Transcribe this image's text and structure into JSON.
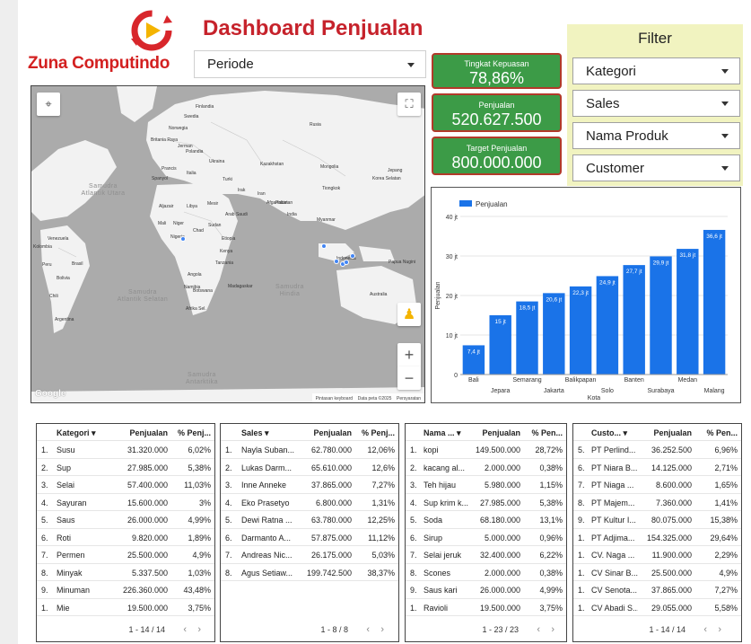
{
  "brand": {
    "name": "Zuna Computindo"
  },
  "header": {
    "title": "Dashboard Penjualan",
    "period_label": "Periode"
  },
  "kpis": [
    {
      "label": "Tingkat Kepuasan",
      "value": "78,86%"
    },
    {
      "label": "Penjualan",
      "value": "520.627.500"
    },
    {
      "label": "Target Penjualan",
      "value": "800.000.000"
    }
  ],
  "filter": {
    "title": "Filter",
    "items": [
      "Kategori",
      "Sales",
      "Nama Produk",
      "Customer"
    ]
  },
  "map": {
    "countries": [
      {
        "name": "Finlandia"
      },
      {
        "name": "Swedia"
      },
      {
        "name": "Norwegia"
      },
      {
        "name": "Rusia"
      },
      {
        "name": "Britania Raya"
      },
      {
        "name": "Jerman"
      },
      {
        "name": "Polandia"
      },
      {
        "name": "Prancis"
      },
      {
        "name": "Ukraina"
      },
      {
        "name": "Kazakhstan"
      },
      {
        "name": "Mongolia"
      },
      {
        "name": "Spanyol"
      },
      {
        "name": "Italia"
      },
      {
        "name": "Turki"
      },
      {
        "name": "Irak"
      },
      {
        "name": "Iran"
      },
      {
        "name": "Afganistan"
      },
      {
        "name": "Tiongkok"
      },
      {
        "name": "Jepang"
      },
      {
        "name": "Korea Selatan"
      },
      {
        "name": "Aljazair"
      },
      {
        "name": "Libya"
      },
      {
        "name": "Mesir"
      },
      {
        "name": "Pakistan"
      },
      {
        "name": "India"
      },
      {
        "name": "Myanmar"
      },
      {
        "name": "Arab Saudi"
      },
      {
        "name": "Mali"
      },
      {
        "name": "Niger"
      },
      {
        "name": "Chad"
      },
      {
        "name": "Sudan"
      },
      {
        "name": "Nigeria"
      },
      {
        "name": "Etiopia"
      },
      {
        "name": "Kenya"
      },
      {
        "name": "Tanzania"
      },
      {
        "name": "Angola"
      },
      {
        "name": "Namibia"
      },
      {
        "name": "Botswana"
      },
      {
        "name": "Afrika Sel."
      },
      {
        "name": "Madagaskar"
      },
      {
        "name": "Indonesia"
      },
      {
        "name": "Papua Nugini"
      },
      {
        "name": "Australia"
      },
      {
        "name": "Venezuela"
      },
      {
        "name": "Kolombia"
      },
      {
        "name": "Peru"
      },
      {
        "name": "Brasil"
      },
      {
        "name": "Bolivia"
      },
      {
        "name": "Chili"
      },
      {
        "name": "Argentina"
      }
    ],
    "oceans": [
      {
        "name": "Samudra Atlantik Utara"
      },
      {
        "name": "Samudra Atlantik Selatan"
      },
      {
        "name": "Samudra Hindia"
      },
      {
        "name": "Samudra Antarktika"
      }
    ],
    "attribution": {
      "google": "Google",
      "shortcuts": "Pintasan keyboard",
      "data": "Data peta ©2025",
      "terms": "Persyaratan"
    },
    "zoom_in": "+",
    "zoom_out": "−"
  },
  "chart_data": {
    "type": "bar",
    "legend": "Penjualan",
    "xlabel": "Kota",
    "ylabel": "Penjualan",
    "ylim": [
      0,
      40
    ],
    "yticks": [
      "0",
      "10 jt",
      "20 jt",
      "30 jt",
      "40 jt"
    ],
    "categories": [
      "Bali",
      "Jepara",
      "Semarang",
      "Jakarta",
      "Balikpapan",
      "Solo",
      "Banten",
      "Surabaya",
      "Medan",
      "Malang"
    ],
    "values": [
      7.4,
      15,
      18.5,
      20.6,
      22.3,
      24.9,
      27.7,
      29.9,
      31.8,
      36.6
    ],
    "labels": [
      "7,4 jt",
      "15 jt",
      "18,5 jt",
      "20,6 jt",
      "22,3 jt",
      "24,9 jt",
      "27,7 jt",
      "29,9 jt",
      "31,8 jt",
      "36,6 jt"
    ],
    "color": "#1a73e8"
  },
  "tables": {
    "kategori": {
      "headers": [
        "Kategori ▾",
        "Penjualan",
        "% Penj..."
      ],
      "rows": [
        [
          "1.",
          "Susu",
          "31.320.000",
          "6,02%"
        ],
        [
          "2.",
          "Sup",
          "27.985.000",
          "5,38%"
        ],
        [
          "3.",
          "Selai",
          "57.400.000",
          "11,03%"
        ],
        [
          "4.",
          "Sayuran",
          "15.600.000",
          "3%"
        ],
        [
          "5.",
          "Saus",
          "26.000.000",
          "4,99%"
        ],
        [
          "6.",
          "Roti",
          "9.820.000",
          "1,89%"
        ],
        [
          "7.",
          "Permen",
          "25.500.000",
          "4,9%"
        ],
        [
          "8.",
          "Minyak",
          "5.337.500",
          "1,03%"
        ],
        [
          "9.",
          "Minuman",
          "226.360.000",
          "43,48%"
        ],
        [
          "1.",
          "Mie",
          "19.500.000",
          "3,75%"
        ]
      ],
      "pager": "1 - 14 / 14"
    },
    "sales": {
      "headers": [
        "Sales ▾",
        "Penjualan",
        "% Penj..."
      ],
      "rows": [
        [
          "1.",
          "Nayla Suban...",
          "62.780.000",
          "12,06%"
        ],
        [
          "2.",
          "Lukas Darm...",
          "65.610.000",
          "12,6%"
        ],
        [
          "3.",
          "Inne Anneke",
          "37.865.000",
          "7,27%"
        ],
        [
          "4.",
          "Eko Prasetyo",
          "6.800.000",
          "1,31%"
        ],
        [
          "5.",
          "Dewi Ratna ...",
          "63.780.000",
          "12,25%"
        ],
        [
          "6.",
          "Darmanto A...",
          "57.875.000",
          "11,12%"
        ],
        [
          "7.",
          "Andreas Nic...",
          "26.175.000",
          "5,03%"
        ],
        [
          "8.",
          "Agus Setiaw...",
          "199.742.500",
          "38,37%"
        ]
      ],
      "pager": "1 - 8 / 8"
    },
    "produk": {
      "headers": [
        "Nama ... ▾",
        "Penjualan",
        "% Pen..."
      ],
      "rows": [
        [
          "1.",
          "kopi",
          "149.500.000",
          "28,72%"
        ],
        [
          "2.",
          "kacang al...",
          "2.000.000",
          "0,38%"
        ],
        [
          "3.",
          "Teh hijau",
          "5.980.000",
          "1,15%"
        ],
        [
          "4.",
          "Sup krim k...",
          "27.985.000",
          "5,38%"
        ],
        [
          "5.",
          "Soda",
          "68.180.000",
          "13,1%"
        ],
        [
          "6.",
          "Sirup",
          "5.000.000",
          "0,96%"
        ],
        [
          "7.",
          "Selai jeruk",
          "32.400.000",
          "6,22%"
        ],
        [
          "8.",
          "Scones",
          "2.000.000",
          "0,38%"
        ],
        [
          "9.",
          "Saus kari",
          "26.000.000",
          "4,99%"
        ],
        [
          "1.",
          "Ravioli",
          "19.500.000",
          "3,75%"
        ]
      ],
      "pager": "1 - 23 / 23"
    },
    "customer": {
      "headers": [
        "Custo... ▾",
        "Penjualan",
        "% Pen..."
      ],
      "rows": [
        [
          "5.",
          "PT Perlind...",
          "36.252.500",
          "6,96%"
        ],
        [
          "6.",
          "PT Niara B...",
          "14.125.000",
          "2,71%"
        ],
        [
          "7.",
          "PT Niaga ...",
          "8.600.000",
          "1,65%"
        ],
        [
          "8.",
          "PT Majem...",
          "7.360.000",
          "1,41%"
        ],
        [
          "9.",
          "PT Kultur I...",
          "80.075.000",
          "15,38%"
        ],
        [
          "1.",
          "PT Adjima...",
          "154.325.000",
          "29,64%"
        ],
        [
          "1.",
          "CV. Naga ...",
          "11.900.000",
          "2,29%"
        ],
        [
          "1.",
          "CV Sinar B...",
          "25.500.000",
          "4,9%"
        ],
        [
          "1.",
          "CV Senota...",
          "37.865.000",
          "7,27%"
        ],
        [
          "1.",
          "CV Abadi S...",
          "29.055.000",
          "5,58%"
        ]
      ],
      "pager": "1 - 14 / 14"
    }
  }
}
